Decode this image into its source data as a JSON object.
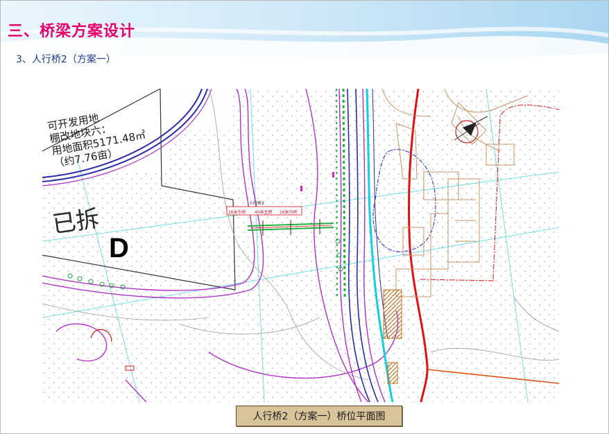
{
  "slide": {
    "title": "三、桥梁方案设计",
    "subtitle": "3、人行桥2（方案一）",
    "caption": "人行桥2（方案一）桥位平面图"
  },
  "map": {
    "open_land_lines": [
      "可开发用地",
      "棚改地块六：",
      "用地面积5171.48㎡",
      "（约7.76亩）"
    ],
    "demolished_label": "已拆",
    "zone_label": "D",
    "bridge_label_left": "16米引桥",
    "bridge_label_mid": "40米主跨",
    "bridge_label_right": "16米引桥",
    "bridge_label_top": "人行桥2"
  },
  "colors": {
    "title": "#e5006a",
    "subtitle": "#1a3a8c",
    "caption_bg": "#d9c49a",
    "road_blue": "#2a2aa8",
    "road_magenta": "#b030c8",
    "river_cyan": "#10d0e0",
    "boundary_red": "#e01010",
    "building_tan": "#c89060",
    "green": "#20b040"
  }
}
